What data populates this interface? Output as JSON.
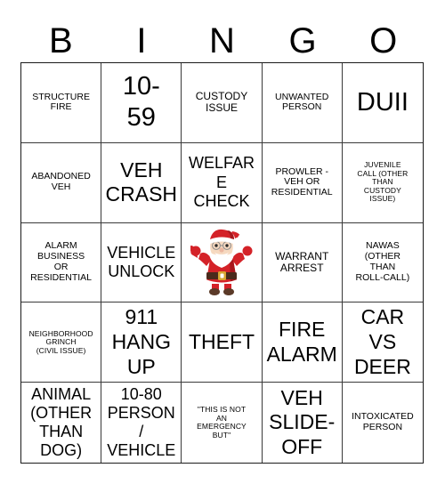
{
  "card": {
    "header_letters": [
      "B",
      "I",
      "N",
      "G",
      "O"
    ],
    "free_space": {
      "icon": "santa-claus-icon",
      "alt": "Santa Claus with arms raised"
    },
    "colors": {
      "text": "#000000",
      "grid_line": "#3a3a3a",
      "border": "#1a1a1a",
      "background": "#ffffff",
      "santa_red": "#d42228",
      "santa_dark_red": "#a8161c",
      "santa_white": "#ffffff",
      "santa_skin": "#f6d9c0",
      "santa_belt": "#4a2a1c",
      "santa_buckle": "#d8a531",
      "santa_boot": "#5b3a28"
    },
    "rows": [
      [
        {
          "text": "STRUCTURE\nFIRE",
          "size": "fs-sm"
        },
        {
          "text": "10-\n59",
          "size": "fs-xxl"
        },
        {
          "text": "CUSTODY\nISSUE",
          "size": "fs-md"
        },
        {
          "text": "UNWANTED\nPERSON",
          "size": "fs-sm"
        },
        {
          "text": "DUII",
          "size": "fs-xxl"
        }
      ],
      [
        {
          "text": "ABANDONED\nVEH",
          "size": "fs-sm"
        },
        {
          "text": "VEH\nCRASH",
          "size": "fs-xl"
        },
        {
          "text": "WELFARE\nCHECK",
          "size": "fs-lg"
        },
        {
          "text": "PROWLER -\nVEH OR\nRESIDENTIAL",
          "size": "fs-sm"
        },
        {
          "text": "JUVENILE\nCALL (OTHER\nTHAN\nCUSTODY\nISSUE)",
          "size": "fs-xs"
        }
      ],
      [
        {
          "text": "ALARM\nBUSINESS\nOR\nRESIDENTIAL",
          "size": "fs-sm"
        },
        {
          "text": "VEHICLE\nUNLOCK",
          "size": "fs-lg"
        },
        {
          "text": "",
          "size": "free"
        },
        {
          "text": "WARRANT\nARREST",
          "size": "fs-md"
        },
        {
          "text": "NAWAS\n(OTHER\nTHAN\nROLL-CALL)",
          "size": "fs-sm"
        }
      ],
      [
        {
          "text": "NEIGHBORHOOD\nGRINCH\n(CIVIL ISSUE)",
          "size": "fs-xs"
        },
        {
          "text": "911\nHANG\nUP",
          "size": "fs-xl"
        },
        {
          "text": "THEFT",
          "size": "fs-xl"
        },
        {
          "text": "FIRE\nALARM",
          "size": "fs-xl"
        },
        {
          "text": "CAR\nVS\nDEER",
          "size": "fs-xl"
        }
      ],
      [
        {
          "text": "ANIMAL\n(OTHER\nTHAN\nDOG)",
          "size": "fs-lg"
        },
        {
          "text": "10-80\nPERSON\n/\nVEHICLE",
          "size": "fs-lg"
        },
        {
          "text": "\"THIS IS NOT\nAN\nEMERGENCY\nBUT\"",
          "size": "fs-xs"
        },
        {
          "text": "VEH\nSLIDE-\nOFF",
          "size": "fs-xl"
        },
        {
          "text": "INTOXICATED\nPERSON",
          "size": "fs-sm"
        }
      ]
    ]
  }
}
